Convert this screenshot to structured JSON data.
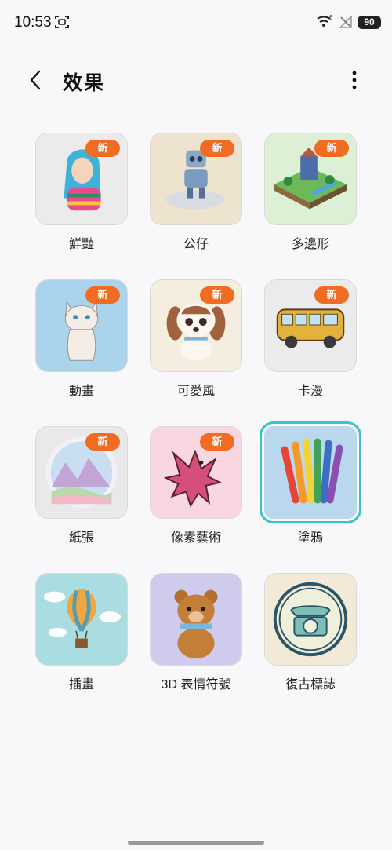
{
  "status_bar": {
    "time": "10:53",
    "wifi_label": "6",
    "battery": "90",
    "icons": [
      "screenshot-icon",
      "wifi-icon",
      "no-signal-icon"
    ]
  },
  "header": {
    "title": "效果",
    "back_icon": "chevron-left-icon",
    "more_icon": "more-vertical-icon"
  },
  "badge_text": "新",
  "effects": [
    {
      "label": "鮮豔",
      "new": true
    },
    {
      "label": "公仔",
      "new": true
    },
    {
      "label": "多邊形",
      "new": true
    },
    {
      "label": "動畫",
      "new": true
    },
    {
      "label": "可愛風",
      "new": true
    },
    {
      "label": "卡漫",
      "new": true
    },
    {
      "label": "紙張",
      "new": true
    },
    {
      "label": "像素藝術",
      "new": true
    },
    {
      "label": "塗鴉",
      "new": false,
      "selected": true
    },
    {
      "label": "插畫",
      "new": false
    },
    {
      "label": "3D 表情符號",
      "new": false
    },
    {
      "label": "復古標誌",
      "new": false
    }
  ],
  "colors": {
    "accent_selected": "#3fc1c9",
    "new_badge": "#f26b22"
  }
}
